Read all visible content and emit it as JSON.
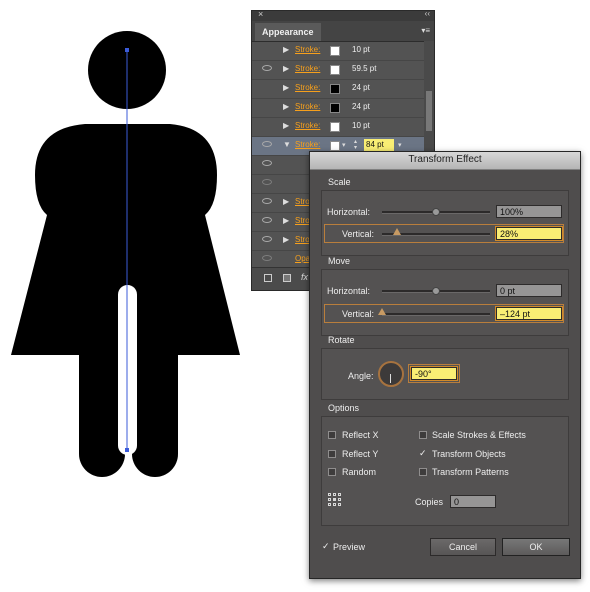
{
  "appearance": {
    "tab_label": "Appearance",
    "close_glyph": "×",
    "collapse_glyph": "‹‹",
    "menu_glyph": "▾≡",
    "rows": [
      {
        "label": "Stroke:",
        "swatch": "#ffffff",
        "value": "10 pt"
      },
      {
        "label": "Stroke:",
        "swatch": "#ffffff",
        "value": "59.5 pt"
      },
      {
        "label": "Stroke:",
        "swatch": "#000000",
        "value": "24 pt"
      },
      {
        "label": "Stroke:",
        "swatch": "#000000",
        "value": "24 pt"
      },
      {
        "label": "Stroke:",
        "swatch": "#ffffff",
        "value": "10 pt"
      },
      {
        "label": "Stroke:",
        "swatch": "#ffffff",
        "value": "84 pt"
      }
    ],
    "partial_rows": [
      "Stro",
      "Stro",
      "Stro",
      "Opa"
    ],
    "fx_label": "fx"
  },
  "dialog": {
    "title": "Transform Effect",
    "scale": {
      "group_title": "Scale",
      "horizontal_label": "Horizontal:",
      "horizontal_value": "100%",
      "vertical_label": "Vertical:",
      "vertical_value": "28%"
    },
    "move": {
      "group_title": "Move",
      "horizontal_label": "Horizontal:",
      "horizontal_value": "0 pt",
      "vertical_label": "Vertical:",
      "vertical_value": "–124 pt"
    },
    "rotate": {
      "group_title": "Rotate",
      "angle_label": "Angle:",
      "angle_value": "-90°"
    },
    "options": {
      "group_title": "Options",
      "reflect_x": "Reflect X",
      "reflect_y": "Reflect Y",
      "random": "Random",
      "scale_strokes": "Scale Strokes & Effects",
      "transform_objects": "Transform Objects",
      "transform_patterns": "Transform Patterns",
      "copies_label": "Copies",
      "copies_value": "0",
      "check_glyph": "✓"
    },
    "preview_label": "Preview",
    "cancel_label": "Cancel",
    "ok_label": "OK"
  },
  "colors": {
    "panel_bg": "#535353",
    "dialog_bg": "#4f4d4d",
    "highlight_field": "#f9ee74",
    "stroke_label": "#f7a01c",
    "selection_path": "#3b5bd9"
  }
}
